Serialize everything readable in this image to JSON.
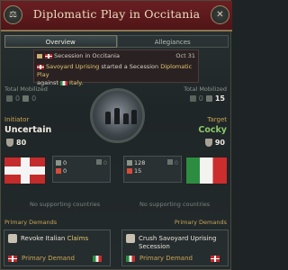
{
  "header": {
    "title": "Diplomatic Play in Occitania",
    "left_icon": "scales-icon",
    "close_icon": "close-icon",
    "close_glyph": "✕",
    "left_glyph": "⚖"
  },
  "tabs": [
    {
      "label": "Overview",
      "active": true
    },
    {
      "label": "Allegiances",
      "active": false
    }
  ],
  "event": {
    "title": "Secession in Occitania",
    "date": "Oct 31",
    "line_parts": {
      "actor": "Savoyard Uprising",
      "mid": " started a Secession ",
      "link": "Diplomatic Play",
      "against": "against",
      "target": "Italy",
      "end": "."
    }
  },
  "initiator": {
    "total_mobilized_label": "Total Mobilized",
    "mobilized_a": "0",
    "mobilized_b": "0",
    "side_label": "Initiator",
    "stance": "Uncertain",
    "score": "80",
    "stats": {
      "bayonet": "0",
      "ship": "0",
      "flag": "0",
      "extra": "0"
    },
    "no_support": "No supporting countries",
    "primary_demands_label": "Primary Demands",
    "demand_title_a": "Revoke Italian ",
    "demand_title_b": "Claims",
    "demand_type": "Primary Demand"
  },
  "target": {
    "total_mobilized_label": "Total Mobilized",
    "mobilized_a": "0",
    "mobilized_b": "15",
    "side_label": "Target",
    "stance": "Cocky",
    "score": "90",
    "stats": {
      "bayonet": "128",
      "ship": "0",
      "flag": "15",
      "extra": "0"
    },
    "no_support": "No supporting countries",
    "primary_demands_label": "Primary Demands",
    "demand_title": "Crush Savoyard Uprising Secession",
    "demand_type": "Primary Demand"
  },
  "colors": {
    "accent_gold": "#c9a653",
    "cocky_green": "#8cc66a",
    "header_red": "#6a1f22"
  }
}
